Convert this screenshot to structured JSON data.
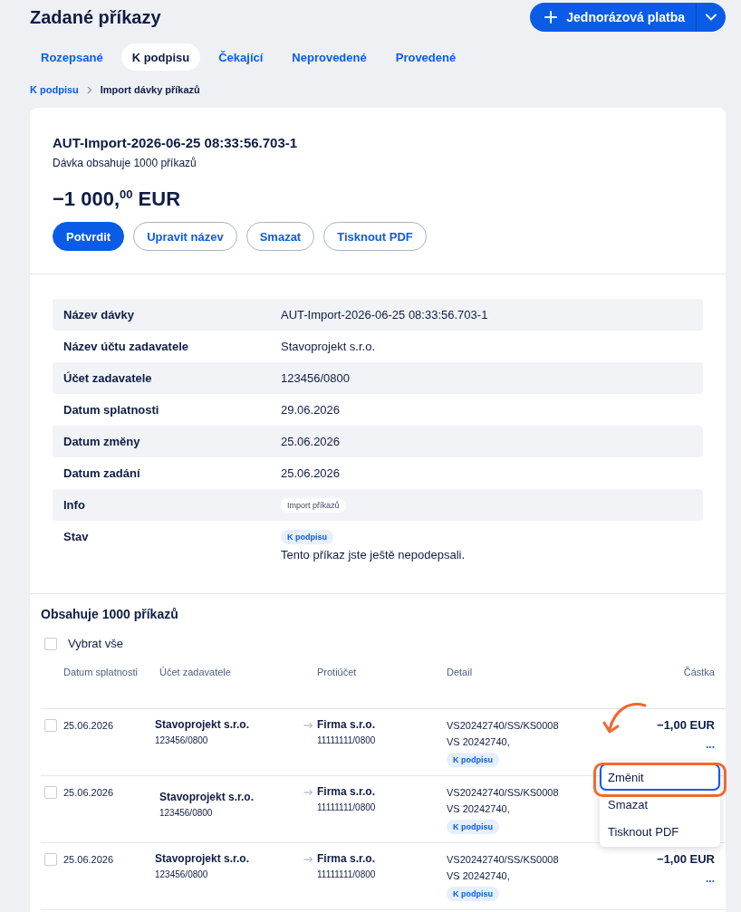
{
  "page": {
    "title": "Zadané příkazy",
    "new_button": {
      "label": "Jednorázová platba"
    }
  },
  "tabs": [
    {
      "label": "Rozepsané",
      "selected": false
    },
    {
      "label": "K podpisu",
      "selected": true
    },
    {
      "label": "Čekající",
      "selected": false
    },
    {
      "label": "Neprovedené",
      "selected": false
    },
    {
      "label": "Provedené",
      "selected": false
    }
  ],
  "breadcrumb": [
    {
      "label": "K podpisu",
      "kind": "link"
    },
    {
      "label": "Import dávky příkazů",
      "kind": "current"
    }
  ],
  "batch": {
    "name": "AUT-Import-2026-06-25 08:33:56.703-1",
    "subtitle": "Dávka obsahuje 1000 příkazů",
    "amount": "−1 000,$^{00}$ EUR",
    "actions": [
      {
        "label": "Potvrdit",
        "primary": true
      },
      {
        "label": "Upravit název",
        "primary": false
      },
      {
        "label": "Smazat",
        "primary": false
      },
      {
        "label": "Tisknout PDF",
        "primary": false
      }
    ]
  },
  "details": [
    {
      "label": "Název dávky",
      "kind": "text",
      "value": "AUT-Import-2026-06-25 08:33:56.703-1"
    },
    {
      "label": "Název účtu zadavatele",
      "kind": "text",
      "value": "Stavoprojekt s.r.o."
    },
    {
      "label": "Účet zadavatele",
      "kind": "text",
      "value": "123456/0800"
    },
    {
      "label": "Datum splatnosti",
      "kind": "text",
      "value": "29.06.2026"
    },
    {
      "label": "Datum změny",
      "kind": "text",
      "value": "25.06.2026"
    },
    {
      "label": "Datum zadání",
      "kind": "text",
      "value": "25.06.2026"
    },
    {
      "label": "Info",
      "kind": "tag",
      "value": "Import příkazů"
    },
    {
      "label": "Stav",
      "kind": "status",
      "value": "K podpisu",
      "note": "Tento příkaz jste ještě nepodepsali."
    }
  ],
  "orders": {
    "title": "Obsahuje 1000 příkazů",
    "select_all": {
      "label": "Vybrat vše",
      "checked": false
    },
    "columns": [
      "Datum splatnosti",
      "Účet zadavatele",
      "Protiúčet",
      "Detail",
      "Částka"
    ],
    "rows": [
      {
        "checked": false,
        "date": "25.06.2026",
        "payer_name": "Stavoprojekt s.r.o.",
        "payer_account": "123456/0800",
        "payee_name": "Firma s.r.o.",
        "payee_account": "11111111/0800",
        "detail_lines": [
          "VS20242740/SS/KS0008",
          "VS 20242740,"
        ],
        "status": "K podpisu",
        "amount": "−1,00 EUR",
        "more": "..."
      },
      {
        "checked": false,
        "date": "25.06.2026",
        "payer_name": "Stavoprojekt s.r.o.",
        "payer_account": "123456/0800",
        "payee_name": "Firma s.r.o.",
        "payee_account": "11111111/0800",
        "detail_lines": [
          "VS20242740/SS/KS0008",
          "VS 20242740,"
        ],
        "status": "K podpisu"
      },
      {
        "checked": false,
        "date": "25.06.2026",
        "payer_name": "Stavoprojekt s.r.o.",
        "payer_account": "123456/0800",
        "payee_name": "Firma s.r.o.",
        "payee_account": "11111111/0800",
        "detail_lines": [
          "VS20242740/SS/KS0008",
          "VS 20242740,"
        ],
        "status": "K podpisu",
        "amount": "−1,00 EUR",
        "more": "..."
      }
    ]
  },
  "context_menu": {
    "items": [
      {
        "label": "Změnit",
        "selected": true,
        "highlighted": true
      },
      {
        "label": "Smazat",
        "selected": false,
        "highlighted": false
      },
      {
        "label": "Tisknout PDF",
        "selected": false,
        "highlighted": false
      }
    ]
  }
}
